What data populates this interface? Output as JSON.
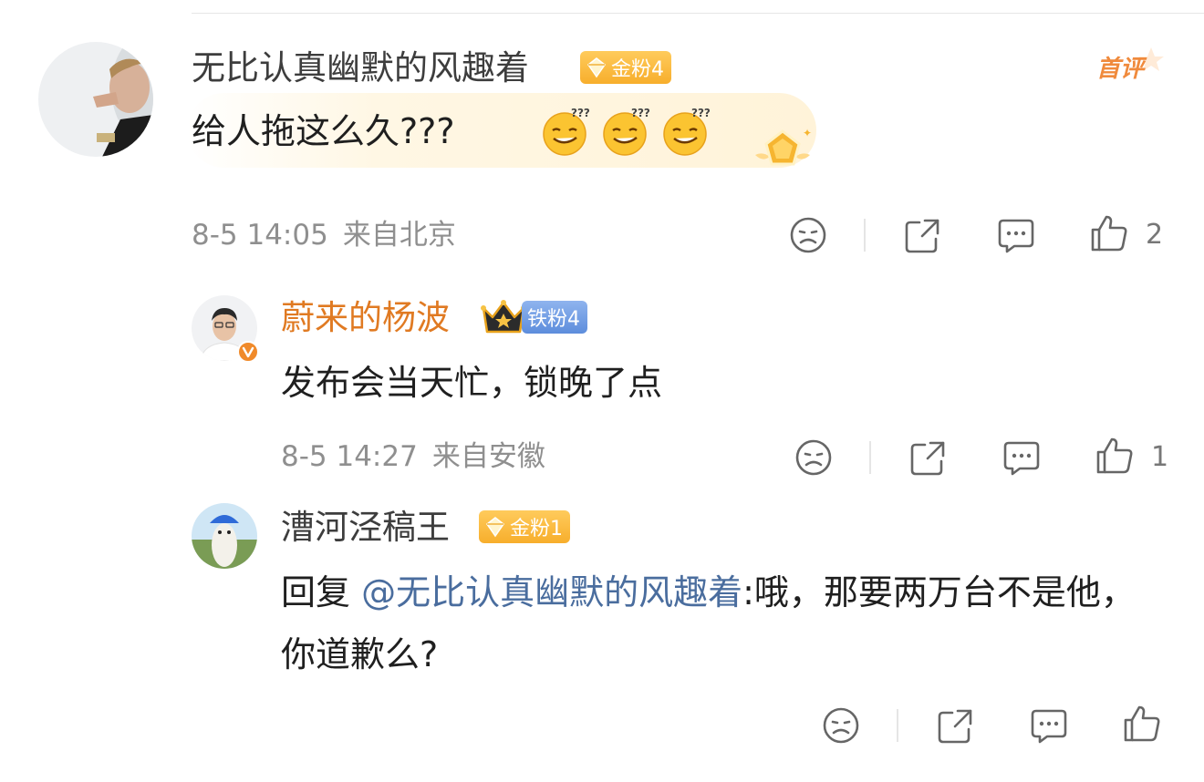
{
  "comments": [
    {
      "username": "无比认真幽默的风趣着",
      "badge": "金粉4",
      "text": "给人拖这么久???",
      "tag": "首评",
      "time": "8-5 14:05",
      "location": "来自北京",
      "likes": "2"
    },
    {
      "username": "蔚来的杨波",
      "badge": "铁粉4",
      "text": "发布会当天忙，锁晚了点",
      "time": "8-5 14:27",
      "location": "来自安徽",
      "likes": "1"
    },
    {
      "username": "漕河泾稿王",
      "badge": "金粉1",
      "reply_prefix": "回复 ",
      "mention": "@无比认真幽默的风趣着",
      "reply_text": ":哦，那要两万台不是他，你道歉么?"
    }
  ],
  "colors": {
    "username_default": "#3d3d3d",
    "username_vip": "#e07a22",
    "mention": "#4a6d9e",
    "meta": "#8f8f8f"
  },
  "icons": [
    "dislike-face-icon",
    "share-icon",
    "comment-icon",
    "like-thumb-icon",
    "verified-v-icon",
    "crown-icon",
    "first-comment-star-icon"
  ]
}
